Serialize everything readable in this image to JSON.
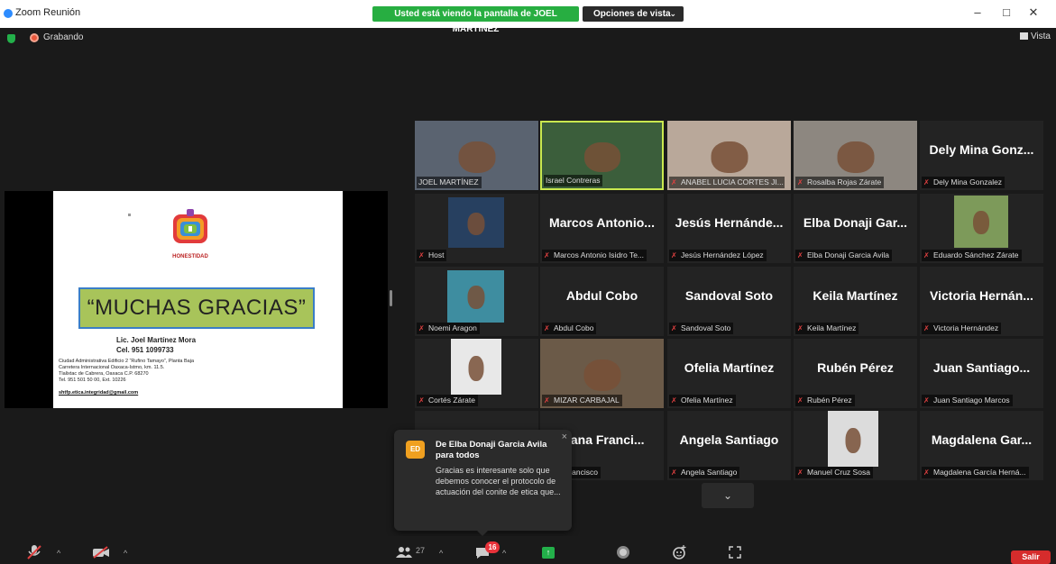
{
  "window": {
    "title": "Zoom Reunión",
    "share_banner": "Usted está viendo la pantalla de JOEL MARTÍNEZ",
    "view_options": "Opciones de vista",
    "minimize": "–",
    "maximize": "□",
    "close": "✕"
  },
  "status": {
    "recording": "Grabando",
    "view": "Vista"
  },
  "slide": {
    "logo_text": "HONESTIDAD",
    "thanks": "“MUCHAS GRACIAS”",
    "name": "Lic. Joel Martínez Mora",
    "cel": "Cel. 951 1099733",
    "address": [
      "Ciudad Administrativa Edificio 2 “Rufino Tamayo”, Planta Baja",
      "Carretera Internacional Oaxaca-Istmo, km. 11.5.",
      "Tlalixtac de Cabrera, Oaxaca C.P. 68270",
      "Tel.  951 501 50 00, Ext. 10226"
    ],
    "email": "shtfp.etica.integridad@gmail.com"
  },
  "participants": [
    {
      "label": "JOEL MARTÍNEZ",
      "big": "",
      "muted": false
    },
    {
      "label": "Israel Contreras",
      "big": "",
      "muted": false,
      "active": true
    },
    {
      "label": "ANABEL LUCIA CORTES JI...",
      "big": "",
      "muted": true
    },
    {
      "label": "Rosalba Rojas Zárate",
      "big": "",
      "muted": true
    },
    {
      "label": "Dely Mina Gonzalez",
      "big": "Dely Mina Gonz...",
      "muted": true
    },
    {
      "label": "Host",
      "big": "",
      "muted": true
    },
    {
      "label": "Marcos Antonio Isidro Te...",
      "big": "Marcos Antonio...",
      "muted": true
    },
    {
      "label": "Jesús Hernández López",
      "big": "Jesús Hernánde...",
      "muted": true
    },
    {
      "label": "Elba Donaji Garcia Avila",
      "big": "Elba Donaji Gar...",
      "muted": true
    },
    {
      "label": "Eduardo Sánchez Zárate",
      "big": "",
      "muted": true
    },
    {
      "label": "Noemi Aragon",
      "big": "",
      "muted": true
    },
    {
      "label": "Abdul Cobo",
      "big": "Abdul Cobo",
      "muted": true
    },
    {
      "label": "Sandoval Soto",
      "big": "Sandoval Soto",
      "muted": true
    },
    {
      "label": "Keila Martínez",
      "big": "Keila Martínez",
      "muted": true
    },
    {
      "label": "Victoria Hernández",
      "big": "Victoria Hernán...",
      "muted": true
    },
    {
      "label": "Cortés Zárate",
      "big": "",
      "muted": true
    },
    {
      "label": "MIZAR CARBAJAL",
      "big": "",
      "muted": true
    },
    {
      "label": "Ofelia Martínez",
      "big": "Ofelia Martínez",
      "muted": true
    },
    {
      "label": "Rubén Pérez",
      "big": "Rubén Pérez",
      "muted": true
    },
    {
      "label": "Juan Santiago Marcos",
      "big": "Juan Santiago...",
      "muted": true
    },
    {
      "label": "",
      "big": "",
      "muted": false
    },
    {
      "label": "diana Francisco",
      "big": "diana Franci...",
      "muted": false
    },
    {
      "label": "Angela Santiago",
      "big": "Angela Santiago",
      "muted": true
    },
    {
      "label": "Manuel Cruz Sosa",
      "big": "",
      "muted": true
    },
    {
      "label": "Magdalena García Herná...",
      "big": "Magdalena Gar...",
      "muted": true
    }
  ],
  "chat": {
    "avatar": "ED",
    "from": "De Elba Donaji Garcia Avila para todos",
    "message": "Gracias es interesante solo que debemos conocer el protocolo de actuación del conite de etica que...",
    "close": "×"
  },
  "toolbar": {
    "participants_count": "27",
    "chat_badge": "16",
    "leave": "Salir"
  },
  "colors": {
    "share_banner": "#27ae41",
    "active_speaker": "#c9e84f",
    "leave": "#d62c2c",
    "chat_badge": "#e8323a"
  }
}
